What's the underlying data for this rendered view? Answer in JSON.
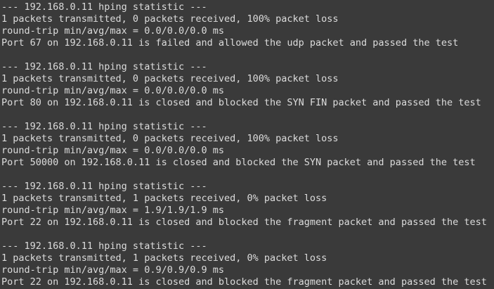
{
  "terminal": {
    "blocks": [
      {
        "header": "--- 192.168.0.11 hping statistic ---",
        "transmit": "1 packets transmitted, 0 packets received, 100% packet loss",
        "rtt": "round-trip min/avg/max = 0.0/0.0/0.0 ms",
        "result": "Port 67 on 192.168.0.11 is failed and allowed the udp packet and passed the test"
      },
      {
        "header": "--- 192.168.0.11 hping statistic ---",
        "transmit": "1 packets transmitted, 0 packets received, 100% packet loss",
        "rtt": "round-trip min/avg/max = 0.0/0.0/0.0 ms",
        "result": "Port 80 on 192.168.0.11 is closed and blocked the SYN FIN packet and passed the test"
      },
      {
        "header": "--- 192.168.0.11 hping statistic ---",
        "transmit": "1 packets transmitted, 0 packets received, 100% packet loss",
        "rtt": "round-trip min/avg/max = 0.0/0.0/0.0 ms",
        "result": "Port 50000 on 192.168.0.11 is closed and blocked the SYN packet and passed the test"
      },
      {
        "header": "--- 192.168.0.11 hping statistic ---",
        "transmit": "1 packets transmitted, 1 packets received, 0% packet loss",
        "rtt": "round-trip min/avg/max = 1.9/1.9/1.9 ms",
        "result": "Port 22 on 192.168.0.11 is closed and blocked the fragment packet and passed the test"
      },
      {
        "header": "--- 192.168.0.11 hping statistic ---",
        "transmit": "1 packets transmitted, 1 packets received, 0% packet loss",
        "rtt": "round-trip min/avg/max = 0.9/0.9/0.9 ms",
        "result": "Port 22 on 192.168.0.11 is closed and blocked the fragment packet and passed the test"
      }
    ],
    "colors": {
      "background": "#3a3a3a",
      "text": "#dcdcdc"
    }
  }
}
